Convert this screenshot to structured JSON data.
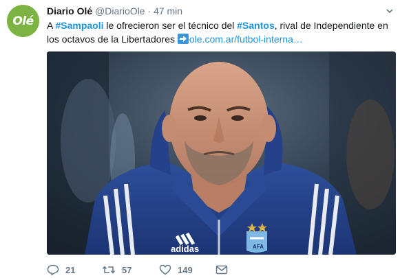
{
  "tweet": {
    "author_name": "Diario Olé",
    "author_handle": "@DiarioOle",
    "separator": "·",
    "time": "47 min",
    "avatar_text": "Olé",
    "text_parts": {
      "t1": "A ",
      "h1": "#Sampaoli",
      "t2": " le ofrecieron ser el técnico del ",
      "h2": "#Santos",
      "t3": ", rival de Independiente en los octavos de la Libertadores  ",
      "link": "ole.com.ar/futbol-interna…"
    },
    "media_icon": "photo-of-man-in-argentina-jacket",
    "stats": {
      "replies": "21",
      "retweets": "57",
      "likes": "149"
    }
  },
  "colors": {
    "accent": "#1b95e0",
    "muted": "#657786",
    "avatar_bg": "#7cb342"
  }
}
